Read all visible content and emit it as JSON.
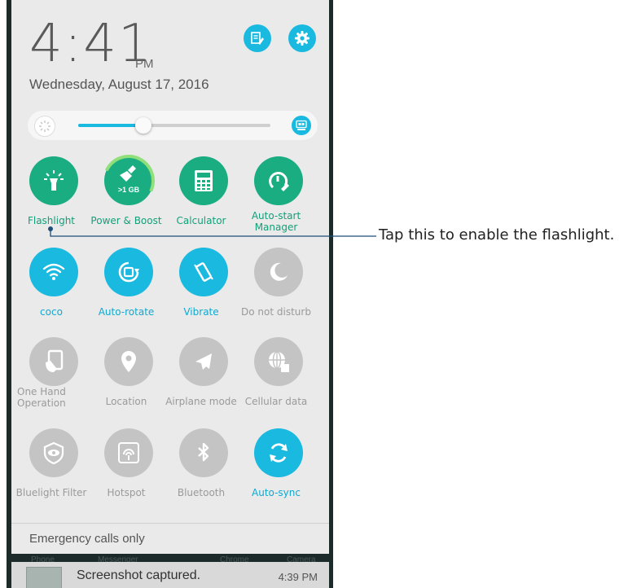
{
  "header": {
    "time": "4:41",
    "ampm": "PM",
    "date": "Wednesday, August 17, 2016"
  },
  "brightness": {
    "level_percent": 34,
    "auto_icon": "auto-brightness-icon"
  },
  "tiles": [
    {
      "label": "Flashlight",
      "icon": "flashlight-icon",
      "state": "green"
    },
    {
      "label": "Power & Boost",
      "icon": "broom-icon",
      "state": "green",
      "sub": ">1 GB"
    },
    {
      "label": "Calculator",
      "icon": "calculator-icon",
      "state": "green"
    },
    {
      "label": "Auto-start Manager",
      "icon": "auto-start-icon",
      "state": "green"
    },
    {
      "label": "coco",
      "icon": "wifi-icon",
      "state": "cyan"
    },
    {
      "label": "Auto-rotate",
      "icon": "auto-rotate-icon",
      "state": "cyan"
    },
    {
      "label": "Vibrate",
      "icon": "vibrate-icon",
      "state": "cyan"
    },
    {
      "label": "Do not disturb",
      "icon": "moon-icon",
      "state": "grey"
    },
    {
      "label": "One Hand Operation",
      "icon": "one-hand-icon",
      "state": "grey"
    },
    {
      "label": "Location",
      "icon": "location-pin-icon",
      "state": "grey"
    },
    {
      "label": "Airplane mode",
      "icon": "airplane-icon",
      "state": "grey"
    },
    {
      "label": "Cellular data",
      "icon": "cellular-data-icon",
      "state": "grey"
    },
    {
      "label": "Bluelight Filter",
      "icon": "eye-filter-icon",
      "state": "grey"
    },
    {
      "label": "Hotspot",
      "icon": "hotspot-icon",
      "state": "grey"
    },
    {
      "label": "Bluetooth",
      "icon": "bluetooth-icon",
      "state": "grey"
    },
    {
      "label": "Auto-sync",
      "icon": "sync-icon",
      "state": "cyan"
    }
  ],
  "status": {
    "emergency": "Emergency calls only"
  },
  "dock_labels": [
    "Phone",
    "Messenger",
    "Chrome",
    "Camera"
  ],
  "notification": {
    "title": "Screenshot captured.",
    "time": "4:39 PM"
  },
  "callout": {
    "text": "Tap this to enable the flashlight."
  },
  "colors": {
    "green": "#1aad81",
    "cyan": "#19b9e0",
    "grey": "#c4c4c4"
  }
}
